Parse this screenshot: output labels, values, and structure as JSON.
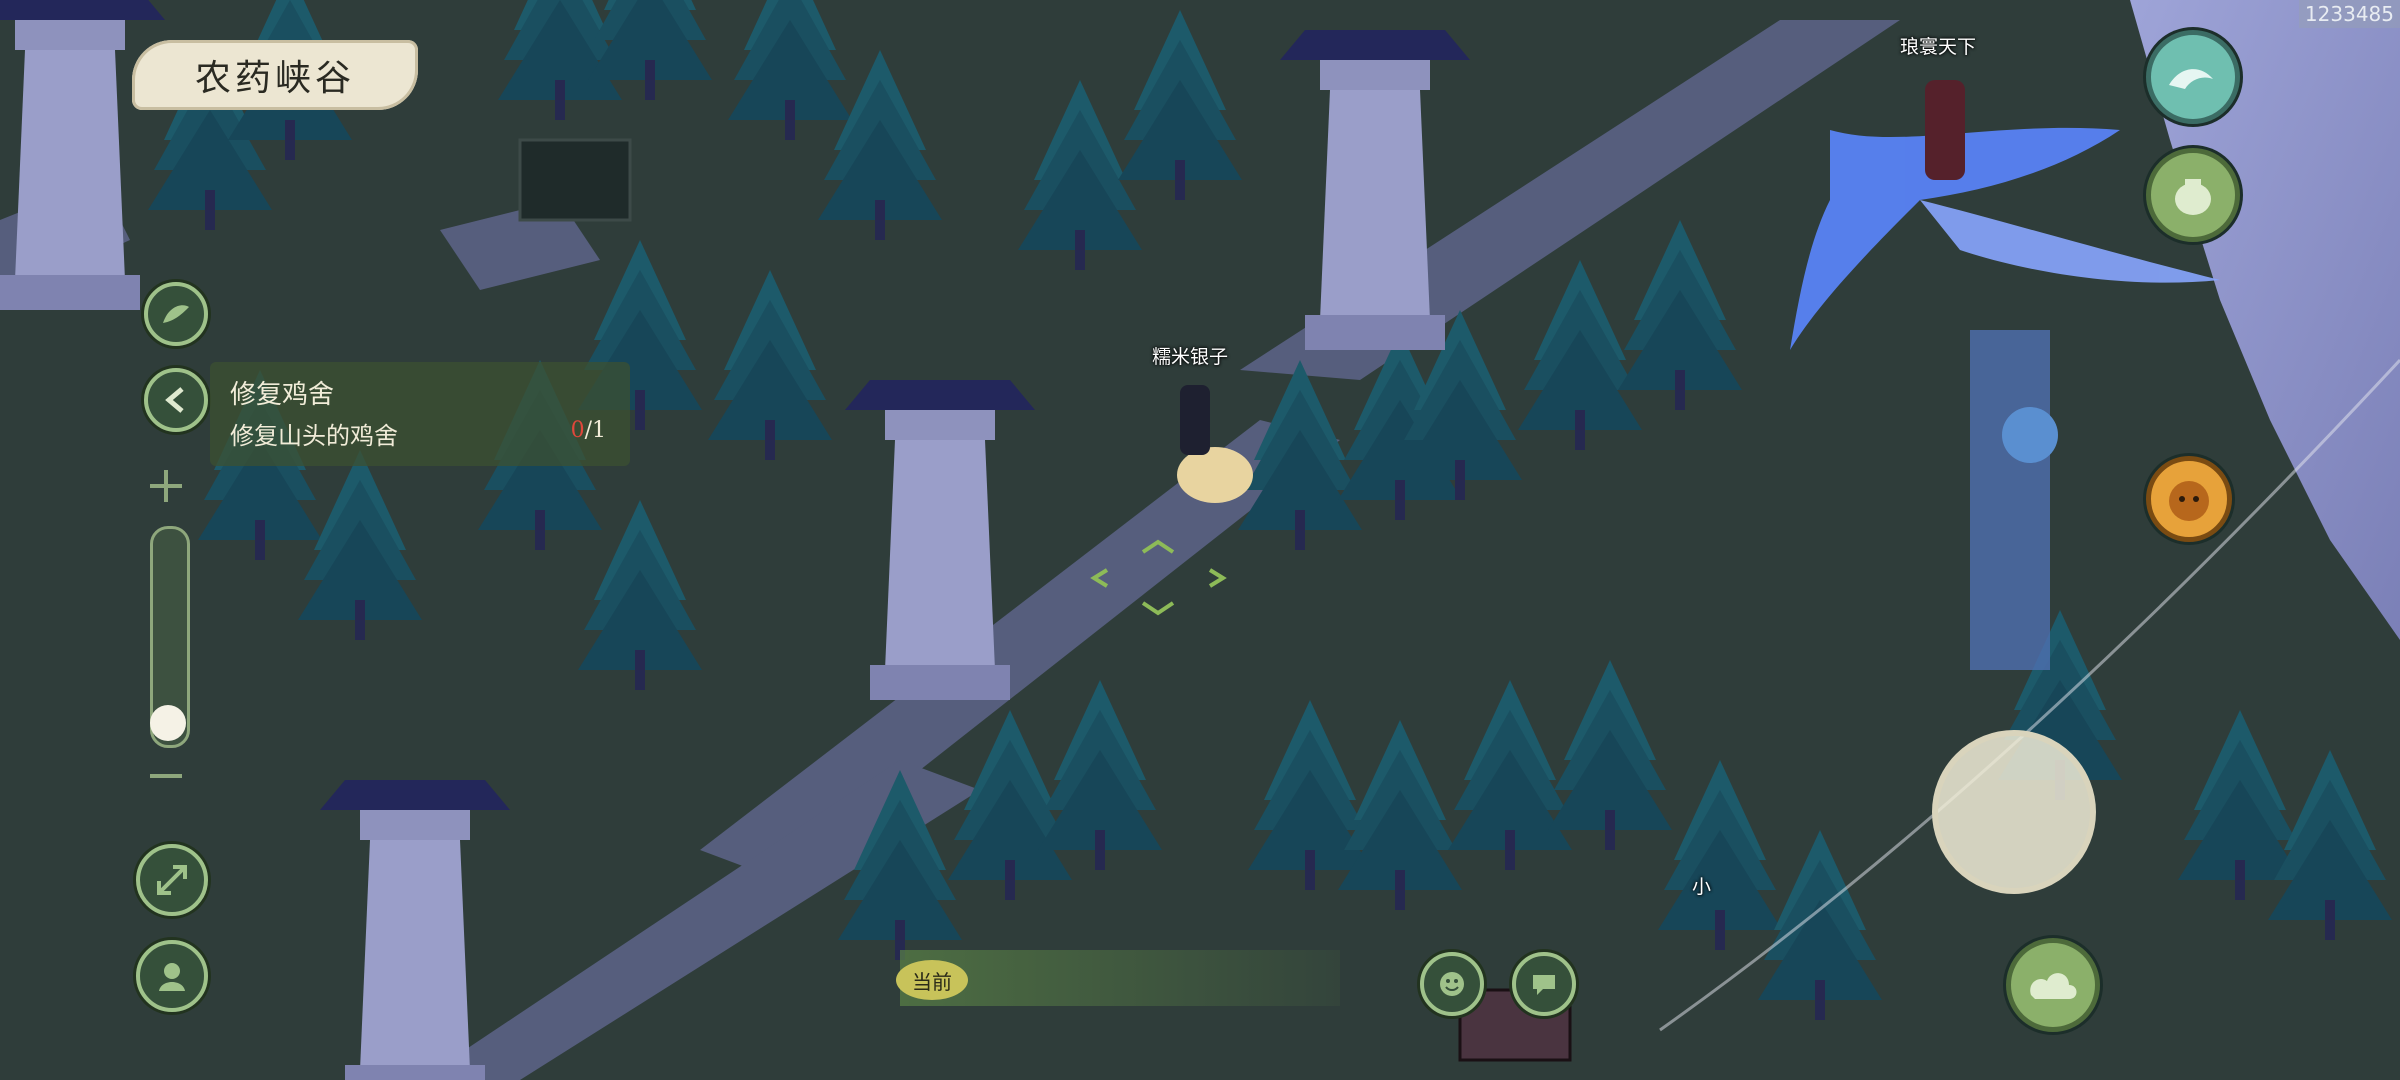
{
  "location": {
    "name": "农药峡谷"
  },
  "uid": "1233485",
  "quest": {
    "title": "修复鸡舍",
    "description": "修复山头的鸡舍",
    "progress_current": "0",
    "progress_total": "/1"
  },
  "players": {
    "self_name": "糯米银子",
    "rider_name": "琅寰天下",
    "other_name_partial": "小"
  },
  "chat": {
    "tag": "当前"
  },
  "zoom": {
    "level": 0.0
  },
  "colors": {
    "ground": "#2f3d3a",
    "path": "#6f7596",
    "tree": "#1f5a68",
    "pillar": "#8d91b8",
    "phoenix": "#5b86ff",
    "progress_red": "#e0473b",
    "ui_green": "#9fc28a",
    "plate": "#ece6d2"
  }
}
